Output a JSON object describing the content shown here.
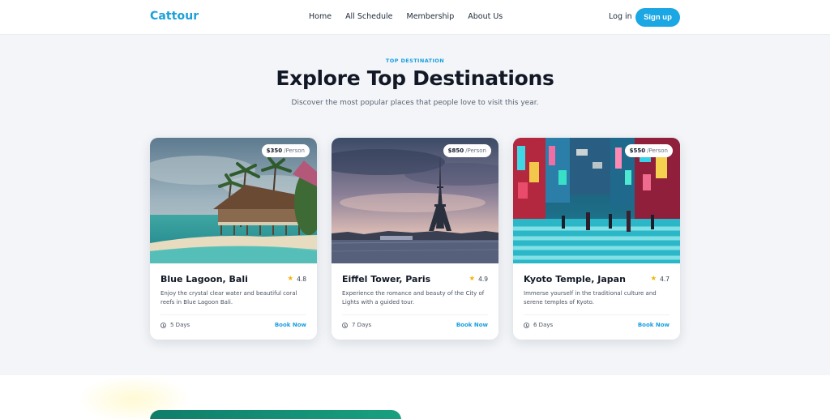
{
  "header": {
    "logo": "Cattour",
    "nav": [
      "Home",
      "All Schedule",
      "Membership",
      "About Us"
    ],
    "login_label": "Log in",
    "signup_label": "Sign up"
  },
  "hero": {
    "eyebrow": "TOP DESTINATION",
    "title": "Explore Top Destinations",
    "subtitle": "Discover the most popular places that people love to visit this year."
  },
  "colors": {
    "brand": "#1aa0d8",
    "signup": "#1ba6e4",
    "star": "#f5b400",
    "banner": "#0f7d6a"
  },
  "cards": [
    {
      "name": "Blue Lagoon, Bali",
      "rating": "4.8",
      "price": "$350",
      "per": "/Person",
      "description": "Enjoy the crystal clear water and beautiful coral reefs in Blue Lagoon Bali.",
      "duration": "5 Days",
      "cta": "Book Now",
      "icon": "clock-icon"
    },
    {
      "name": "Eiffel Tower, Paris",
      "rating": "4.9",
      "price": "$850",
      "per": "/Person",
      "description": "Experience the romance and beauty of the City of Lights with a guided tour.",
      "duration": "7 Days",
      "cta": "Book Now",
      "icon": "clock-icon"
    },
    {
      "name": "Kyoto Temple, Japan",
      "rating": "4.7",
      "price": "$550",
      "per": "/Person",
      "description": "Immerse yourself in the traditional culture and serene temples of Kyoto.",
      "duration": "6 Days",
      "cta": "Book Now",
      "icon": "clock-icon"
    }
  ]
}
